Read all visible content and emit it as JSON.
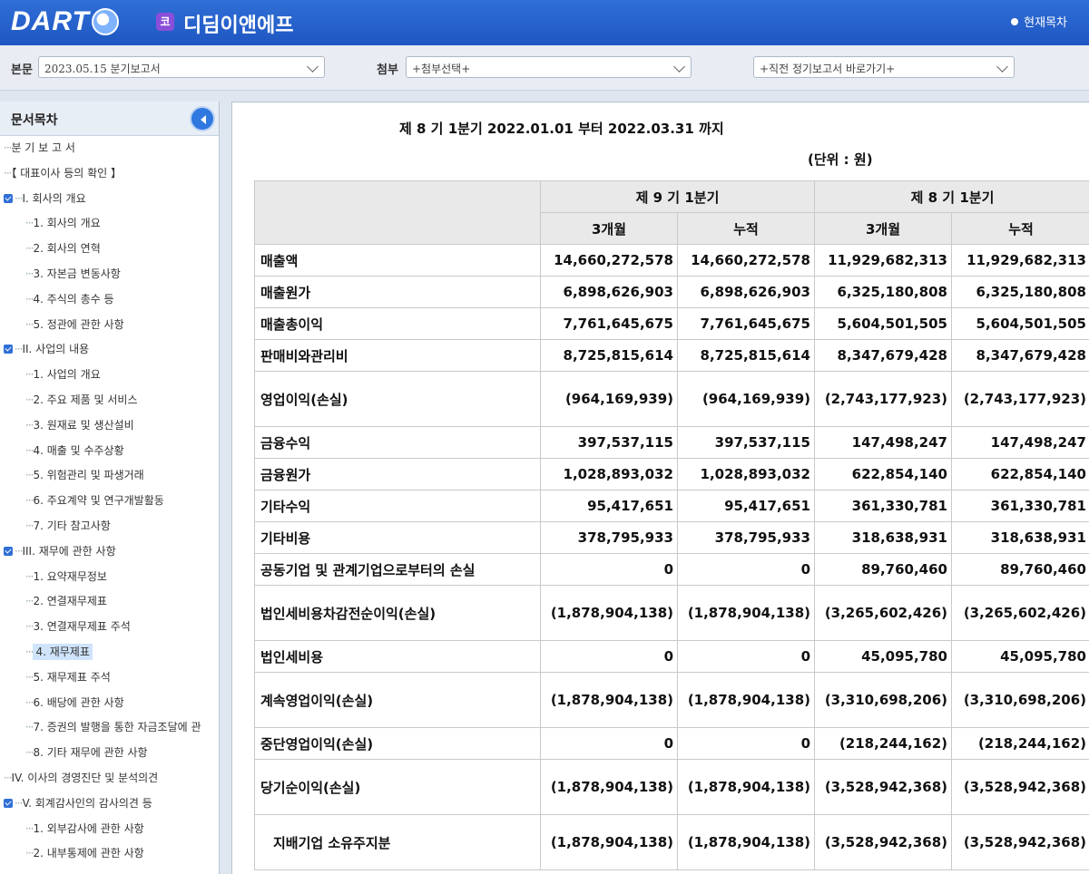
{
  "header": {
    "logo_text": "DART",
    "corp_badge": "코",
    "corp_name": "디딤이앤에프",
    "toc_link": "현재목차"
  },
  "selectors": {
    "main_label": "본문",
    "main_value": "2023.05.15  분기보고서",
    "attach_label": "첨부",
    "attach_value": "+첨부선택+",
    "prev_value": "+직전 정기보고서 바로가기+"
  },
  "sidebar": {
    "title": "문서목차",
    "items": [
      {
        "label": "분 기 보 고 서",
        "level": 0,
        "checked": false,
        "selected": false
      },
      {
        "label": "【 대표이사 등의 확인 】",
        "level": 0,
        "checked": false,
        "selected": false
      },
      {
        "label": "I. 회사의 개요",
        "level": 0,
        "checked": true,
        "selected": false
      },
      {
        "label": "1. 회사의 개요",
        "level": 1,
        "checked": false,
        "selected": false
      },
      {
        "label": "2. 회사의 연혁",
        "level": 1,
        "checked": false,
        "selected": false
      },
      {
        "label": "3. 자본금 변동사항",
        "level": 1,
        "checked": false,
        "selected": false
      },
      {
        "label": "4. 주식의 총수 등",
        "level": 1,
        "checked": false,
        "selected": false
      },
      {
        "label": "5. 정관에 관한 사항",
        "level": 1,
        "checked": false,
        "selected": false
      },
      {
        "label": "II. 사업의 내용",
        "level": 0,
        "checked": true,
        "selected": false
      },
      {
        "label": "1. 사업의 개요",
        "level": 1,
        "checked": false,
        "selected": false
      },
      {
        "label": "2. 주요 제품 및 서비스",
        "level": 1,
        "checked": false,
        "selected": false
      },
      {
        "label": "3. 원재료 및 생산설비",
        "level": 1,
        "checked": false,
        "selected": false
      },
      {
        "label": "4. 매출 및 수주상황",
        "level": 1,
        "checked": false,
        "selected": false
      },
      {
        "label": "5. 위험관리 및 파생거래",
        "level": 1,
        "checked": false,
        "selected": false
      },
      {
        "label": "6. 주요계약 및 연구개발활동",
        "level": 1,
        "checked": false,
        "selected": false
      },
      {
        "label": "7. 기타 참고사항",
        "level": 1,
        "checked": false,
        "selected": false
      },
      {
        "label": "III. 재무에 관한 사항",
        "level": 0,
        "checked": true,
        "selected": false
      },
      {
        "label": "1. 요약재무정보",
        "level": 1,
        "checked": false,
        "selected": false
      },
      {
        "label": "2. 연결재무제표",
        "level": 1,
        "checked": false,
        "selected": false
      },
      {
        "label": "3. 연결재무제표 주석",
        "level": 1,
        "checked": false,
        "selected": false
      },
      {
        "label": "4. 재무제표",
        "level": 1,
        "checked": false,
        "selected": true
      },
      {
        "label": "5. 재무제표 주석",
        "level": 1,
        "checked": false,
        "selected": false
      },
      {
        "label": "6. 배당에 관한 사항",
        "level": 1,
        "checked": false,
        "selected": false
      },
      {
        "label": "7. 증권의 발행을 통한 자금조달에 관",
        "level": 1,
        "checked": false,
        "selected": false
      },
      {
        "label": "8. 기타 재무에 관한 사항",
        "level": 1,
        "checked": false,
        "selected": false
      },
      {
        "label": "IV. 이사의 경영진단 및 분석의견",
        "level": 0,
        "checked": false,
        "selected": false
      },
      {
        "label": "V. 회계감사인의 감사의견 등",
        "level": 0,
        "checked": true,
        "selected": false
      },
      {
        "label": "1. 외부감사에 관한 사항",
        "level": 1,
        "checked": false,
        "selected": false
      },
      {
        "label": "2. 내부통제에 관한 사항",
        "level": 1,
        "checked": false,
        "selected": false
      }
    ]
  },
  "content": {
    "period_text": "제 8 기 1분기 2022.01.01 부터 2022.03.31 까지",
    "unit_text": "(단위 : 원)",
    "table": {
      "group_headers": [
        "제 9 기 1분기",
        "제 8 기 1분기"
      ],
      "sub_headers": [
        "3개월",
        "누적",
        "3개월",
        "누적"
      ],
      "rows": [
        {
          "name": "매출액",
          "values": [
            "14,660,272,578",
            "14,660,272,578",
            "11,929,682,313",
            "11,929,682,313"
          ],
          "tall": false,
          "indent": false
        },
        {
          "name": "매출원가",
          "values": [
            "6,898,626,903",
            "6,898,626,903",
            "6,325,180,808",
            "6,325,180,808"
          ],
          "tall": false,
          "indent": false
        },
        {
          "name": "매출총이익",
          "values": [
            "7,761,645,675",
            "7,761,645,675",
            "5,604,501,505",
            "5,604,501,505"
          ],
          "tall": false,
          "indent": false
        },
        {
          "name": "판매비와관리비",
          "values": [
            "8,725,815,614",
            "8,725,815,614",
            "8,347,679,428",
            "8,347,679,428"
          ],
          "tall": false,
          "indent": false
        },
        {
          "name": "영업이익(손실)",
          "values": [
            "(964,169,939)",
            "(964,169,939)",
            "(2,743,177,923)",
            "(2,743,177,923)"
          ],
          "tall": true,
          "indent": false
        },
        {
          "name": "금융수익",
          "values": [
            "397,537,115",
            "397,537,115",
            "147,498,247",
            "147,498,247"
          ],
          "tall": false,
          "indent": false
        },
        {
          "name": "금융원가",
          "values": [
            "1,028,893,032",
            "1,028,893,032",
            "622,854,140",
            "622,854,140"
          ],
          "tall": false,
          "indent": false
        },
        {
          "name": "기타수익",
          "values": [
            "95,417,651",
            "95,417,651",
            "361,330,781",
            "361,330,781"
          ],
          "tall": false,
          "indent": false
        },
        {
          "name": "기타비용",
          "values": [
            "378,795,933",
            "378,795,933",
            "318,638,931",
            "318,638,931"
          ],
          "tall": false,
          "indent": false
        },
        {
          "name": "공동기업 및 관계기업으로부터의 손실",
          "values": [
            "0",
            "0",
            "89,760,460",
            "89,760,460"
          ],
          "tall": false,
          "indent": false
        },
        {
          "name": "법인세비용차감전순이익(손실)",
          "values": [
            "(1,878,904,138)",
            "(1,878,904,138)",
            "(3,265,602,426)",
            "(3,265,602,426)"
          ],
          "tall": true,
          "indent": false
        },
        {
          "name": "법인세비용",
          "values": [
            "0",
            "0",
            "45,095,780",
            "45,095,780"
          ],
          "tall": false,
          "indent": false
        },
        {
          "name": "계속영업이익(손실)",
          "values": [
            "(1,878,904,138)",
            "(1,878,904,138)",
            "(3,310,698,206)",
            "(3,310,698,206)"
          ],
          "tall": true,
          "indent": false
        },
        {
          "name": "중단영업이익(손실)",
          "values": [
            "0",
            "0",
            "(218,244,162)",
            "(218,244,162)"
          ],
          "tall": false,
          "indent": false
        },
        {
          "name": "당기순이익(손실)",
          "values": [
            "(1,878,904,138)",
            "(1,878,904,138)",
            "(3,528,942,368)",
            "(3,528,942,368)"
          ],
          "tall": true,
          "indent": false
        },
        {
          "name": "지배기업 소유주지분",
          "values": [
            "(1,878,904,138)",
            "(1,878,904,138)",
            "(3,528,942,368)",
            "(3,528,942,368)"
          ],
          "tall": true,
          "indent": true
        }
      ]
    }
  }
}
